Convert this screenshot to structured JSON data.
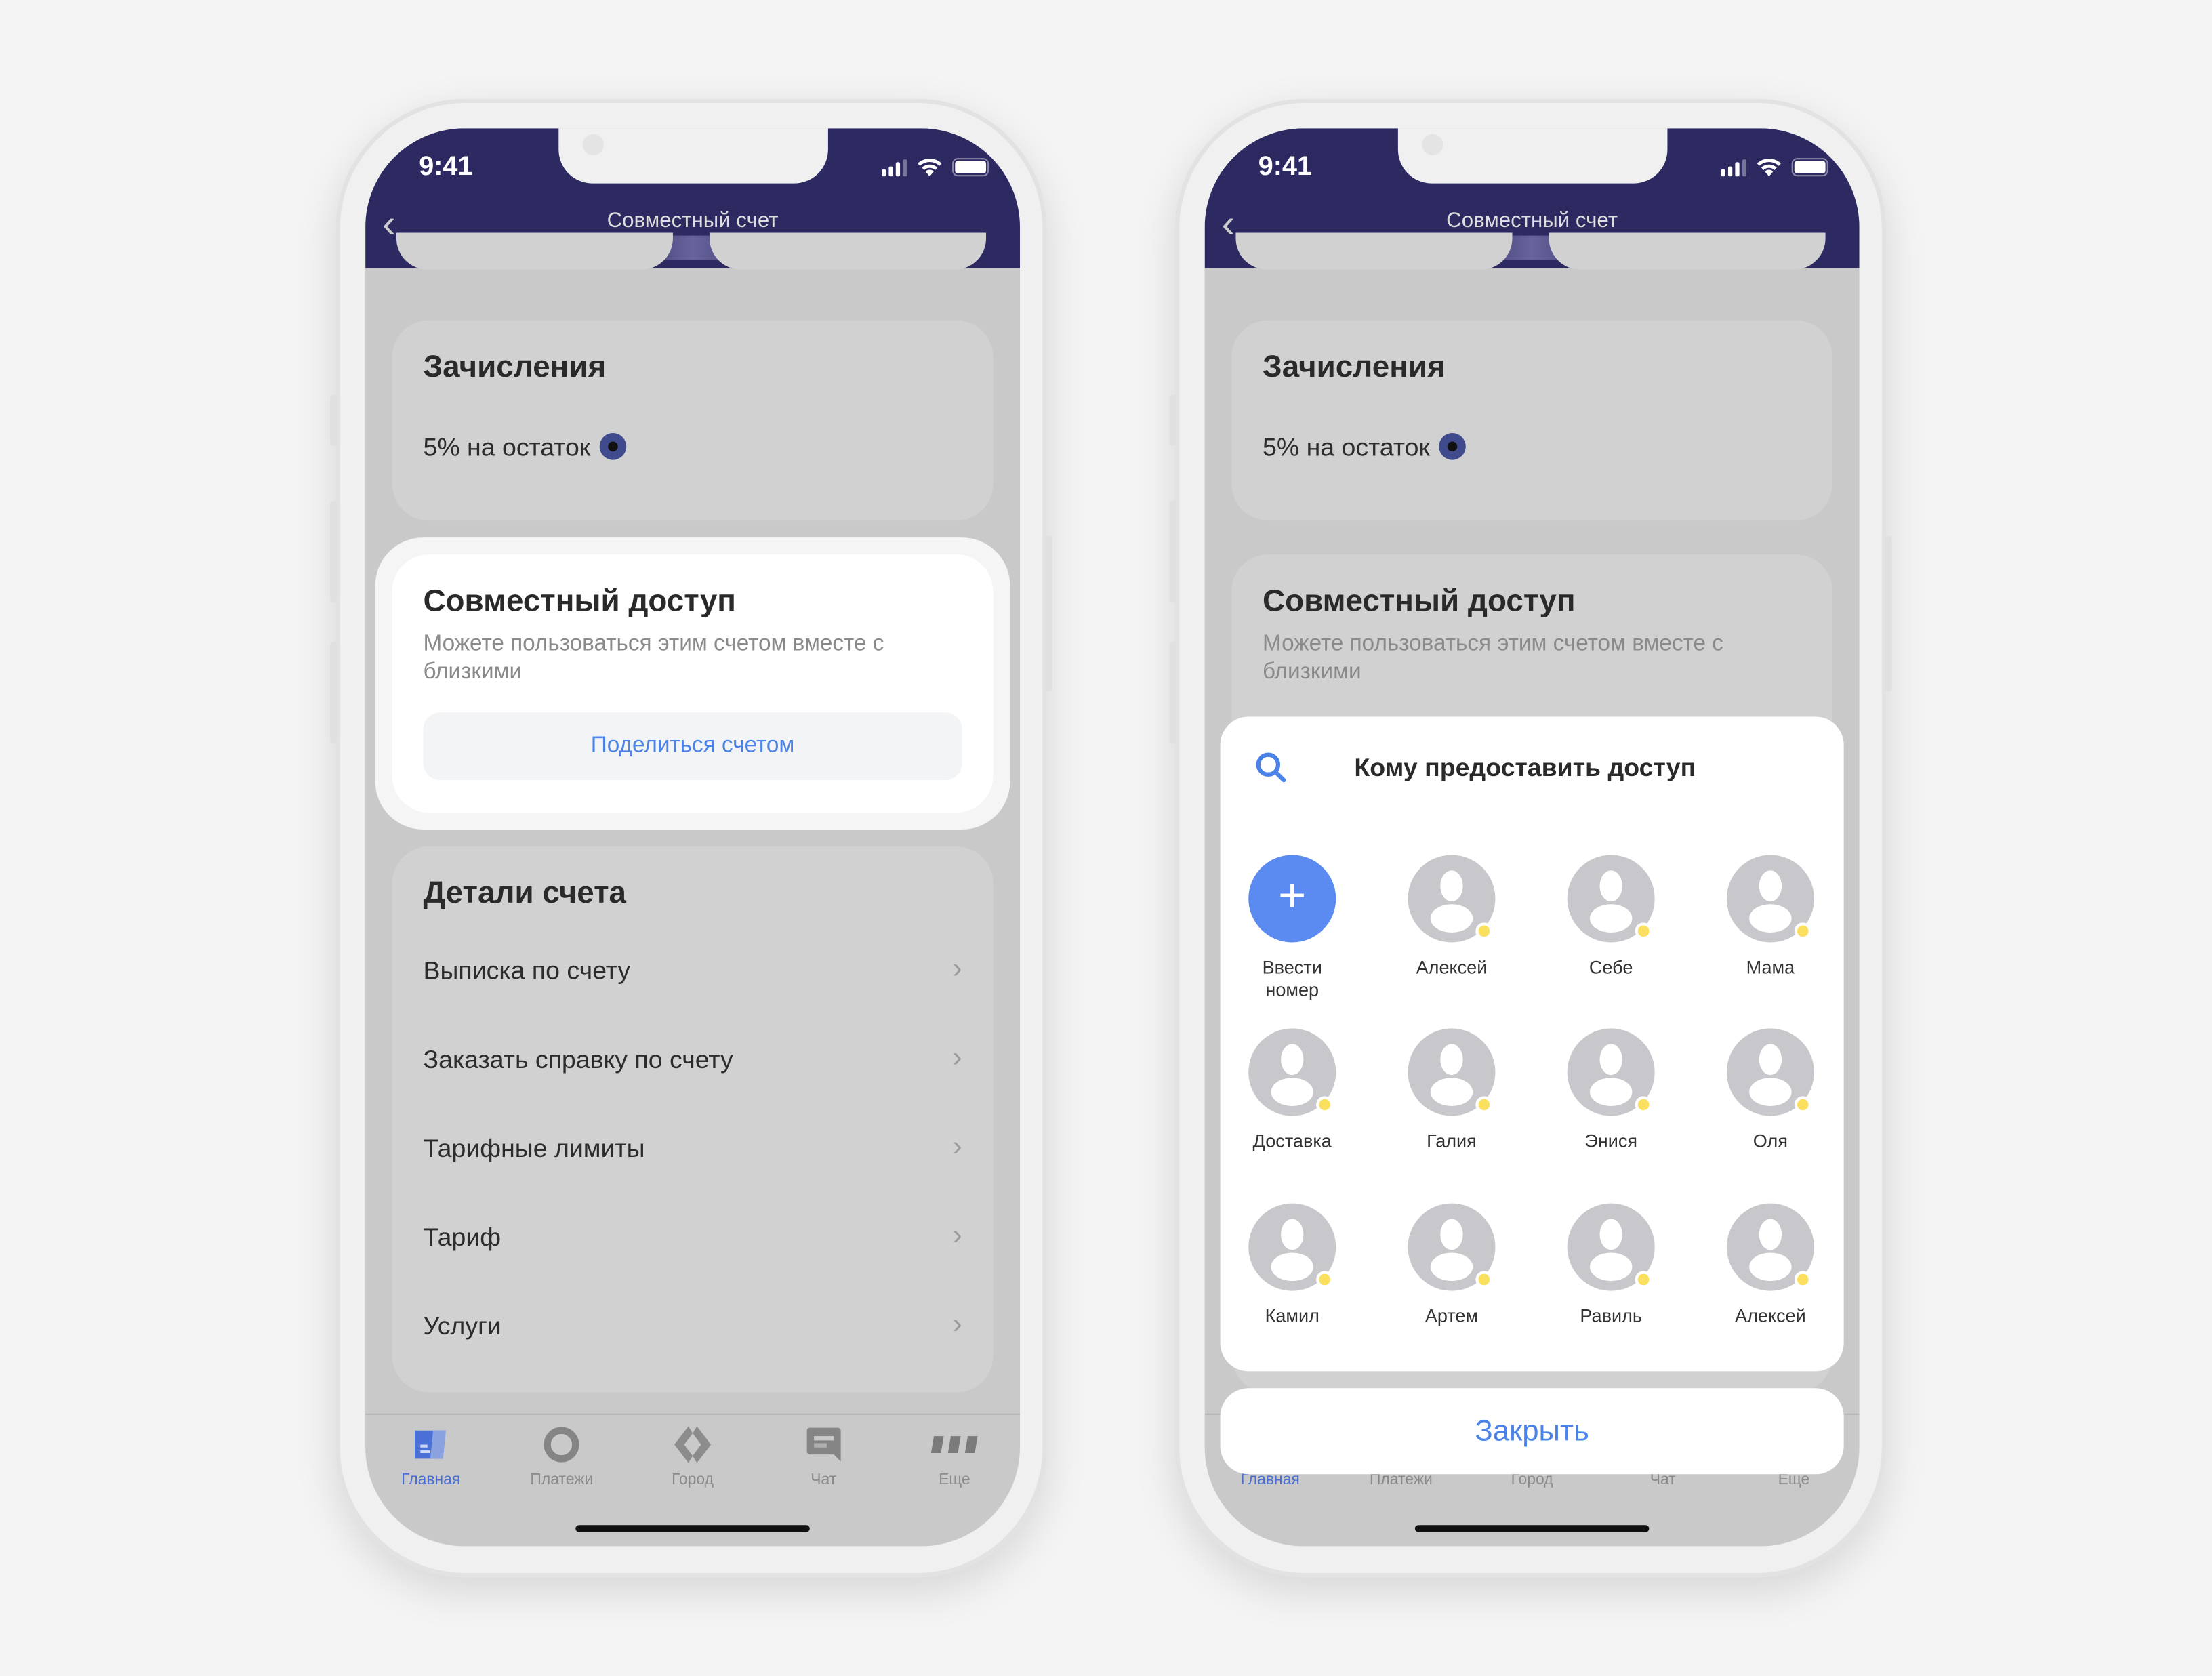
{
  "status": {
    "time": "9:41"
  },
  "header": {
    "title": "Совместный счет"
  },
  "accruals": {
    "title": "Зачисления",
    "rate": "5% на остаток"
  },
  "shared": {
    "title": "Совместный доступ",
    "subtitle": "Можете пользоваться этим счетом вместе с близкими",
    "share_button": "Поделиться счетом"
  },
  "details": {
    "title": "Детали счета",
    "items": [
      {
        "label": "Выписка по счету"
      },
      {
        "label": "Заказать справку по счету"
      },
      {
        "label": "Тарифные лимиты"
      },
      {
        "label": "Тариф"
      },
      {
        "label": "Услуги"
      }
    ]
  },
  "tabbar": {
    "active": "Главная",
    "items": [
      {
        "label": "Главная",
        "icon": "home-card-icon"
      },
      {
        "label": "Платежи",
        "icon": "ring-icon"
      },
      {
        "label": "Город",
        "icon": "city-diamond-icon"
      },
      {
        "label": "Чат",
        "icon": "chat-icon"
      },
      {
        "label": "Еще",
        "icon": "more-icon"
      }
    ]
  },
  "sheet": {
    "title": "Кому предоставить доступ",
    "add_label": "Ввести номер",
    "contacts": [
      "Алексей",
      "Себе",
      "Мама",
      "Доставка",
      "Галия",
      "Энися",
      "Оля",
      "Камил",
      "Артем",
      "Равиль",
      "Алексей"
    ],
    "close": "Закрыть"
  },
  "colors": {
    "header": "#2d2a62",
    "accent": "#5b8af0",
    "online_dot": "#fbe060"
  }
}
